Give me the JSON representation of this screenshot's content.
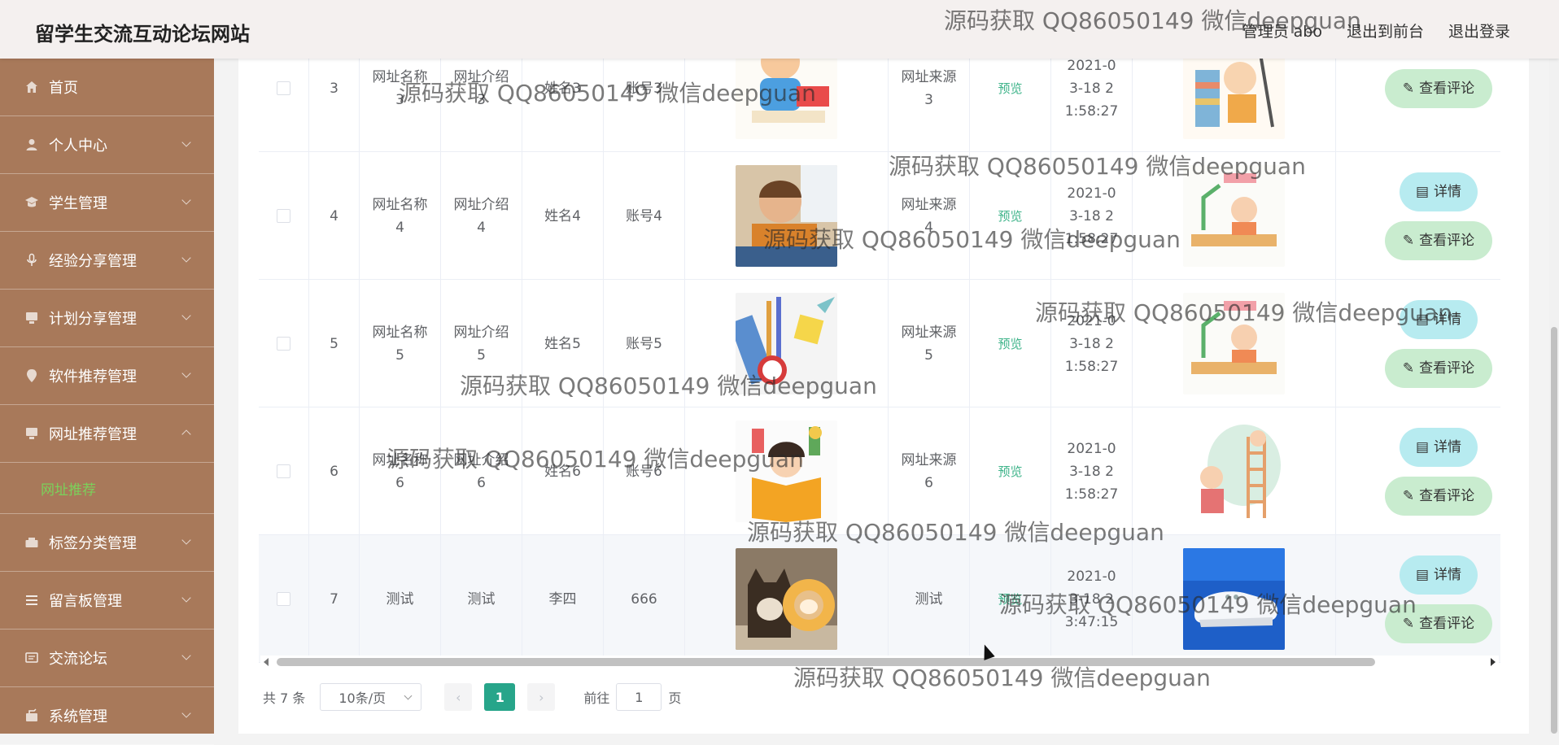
{
  "header": {
    "title": "留学生交流互动论坛网站",
    "admin_label": "管理员 abo",
    "back_to_front": "退出到前台",
    "logout": "退出登录"
  },
  "sidebar": {
    "items": [
      {
        "label": "首页",
        "icon": "home-icon"
      },
      {
        "label": "个人中心",
        "icon": "user-icon"
      },
      {
        "label": "学生管理",
        "icon": "student-icon"
      },
      {
        "label": "经验分享管理",
        "icon": "mic-icon"
      },
      {
        "label": "计划分享管理",
        "icon": "monitor-icon"
      },
      {
        "label": "软件推荐管理",
        "icon": "location-icon"
      },
      {
        "label": "网址推荐管理",
        "icon": "monitor-icon"
      },
      {
        "label": "标签分类管理",
        "icon": "folder-icon"
      },
      {
        "label": "留言板管理",
        "icon": "list-icon"
      },
      {
        "label": "交流论坛",
        "icon": "chat-icon"
      },
      {
        "label": "系统管理",
        "icon": "gear-icon"
      }
    ],
    "active_sub": "网址推荐"
  },
  "table": {
    "preview_label": "预览",
    "detail_label": "详情",
    "comment_label": "查看评论",
    "rows": [
      {
        "idx": "3",
        "name": "网址名称3",
        "intro": "网址介绍3",
        "person": "姓名3",
        "account": "账号3",
        "source": "网址来源3",
        "time": "2021-03-18 21:58:27"
      },
      {
        "idx": "4",
        "name": "网址名称4",
        "intro": "网址介绍4",
        "person": "姓名4",
        "account": "账号4",
        "source": "网址来源4",
        "time": "2021-03-18 21:58:27"
      },
      {
        "idx": "5",
        "name": "网址名称5",
        "intro": "网址介绍5",
        "person": "姓名5",
        "account": "账号5",
        "source": "网址来源5",
        "time": "2021-03-18 21:58:27"
      },
      {
        "idx": "6",
        "name": "网址名称6",
        "intro": "网址介绍6",
        "person": "姓名6",
        "account": "账号6",
        "source": "网址来源6",
        "time": "2021-03-18 21:58:27"
      },
      {
        "idx": "7",
        "name": "测试",
        "intro": "测试",
        "person": "李四",
        "account": "666",
        "source": "测试",
        "time": "2021-03-18 23:47:15"
      }
    ]
  },
  "pagination": {
    "total": "共 7 条",
    "page_size": "10条/页",
    "current_page": "1",
    "goto_label": "前往",
    "goto_value": "1",
    "page_suffix": "页"
  },
  "watermark": "源码获取 QQ86050149 微信deepguan",
  "colors": {
    "sidebar": "#a8795a",
    "accent": "#27a58a",
    "submenu_active": "#7bd15a",
    "detail_btn": "#b7ebf0",
    "comment_btn": "#c9eccf"
  }
}
